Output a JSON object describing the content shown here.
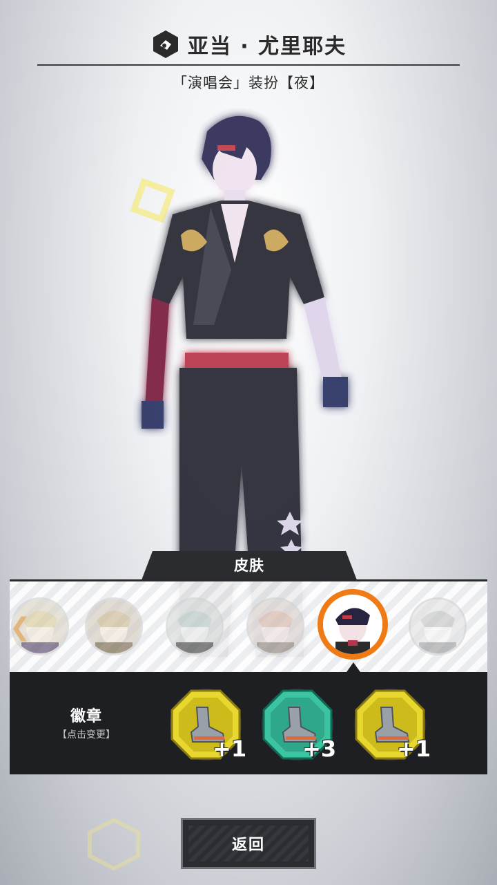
{
  "header": {
    "character_name": "亚当 · 尤里耶夫",
    "outfit_name": "「演唱会」装扮【夜】"
  },
  "skin": {
    "tab_label": "皮肤",
    "selected_index": 4,
    "items": [
      {
        "id": "skin-1"
      },
      {
        "id": "skin-2"
      },
      {
        "id": "skin-3"
      },
      {
        "id": "skin-4"
      },
      {
        "id": "skin-5"
      },
      {
        "id": "skin-6"
      }
    ]
  },
  "badges": {
    "label": "徽章",
    "hint": "【点击变更】",
    "items": [
      {
        "icon": "boot-icon",
        "color": "#e8d72e",
        "level": "+1"
      },
      {
        "icon": "boot-icon",
        "color": "#3cc4a0",
        "level": "+3"
      },
      {
        "icon": "boot-icon",
        "color": "#e8d72e",
        "level": "+1"
      }
    ]
  },
  "footer": {
    "back_label": "返回"
  },
  "colors": {
    "accent": "#f07a14",
    "panel": "#1d1f22"
  }
}
